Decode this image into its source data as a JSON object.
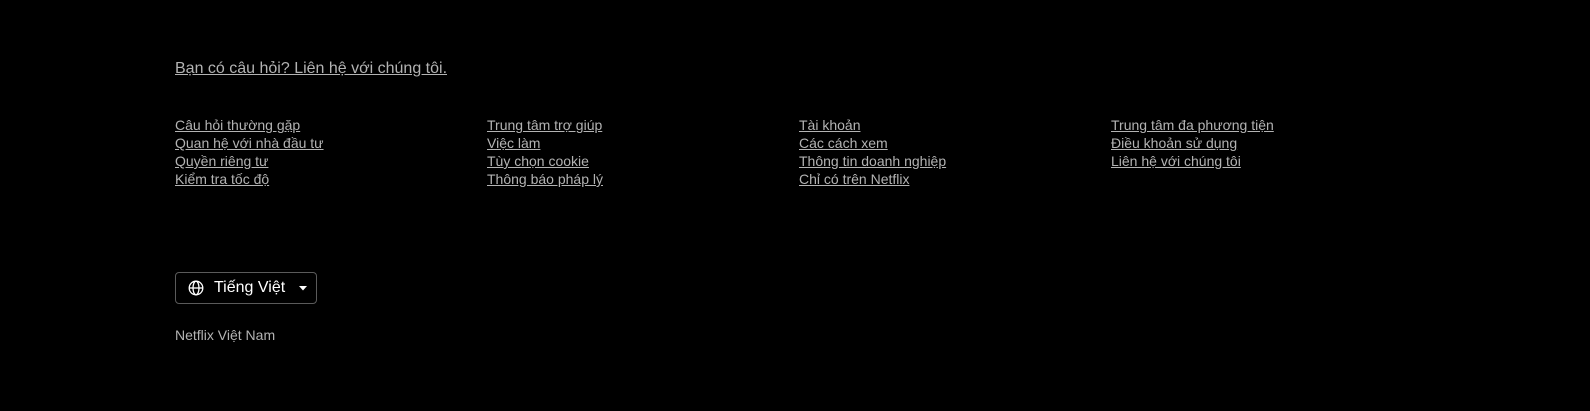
{
  "footer": {
    "contact_text": "Bạn có câu hỏi? Liên hệ với chúng tôi.",
    "columns": [
      [
        "Câu hỏi thường gặp",
        "Quan hệ với nhà đầu tư",
        "Quyền riêng tư",
        "Kiểm tra tốc độ"
      ],
      [
        "Trung tâm trợ giúp",
        "Việc làm",
        "Tùy chọn cookie",
        "Thông báo pháp lý"
      ],
      [
        "Tài khoản",
        "Các cách xem",
        "Thông tin doanh nghiệp",
        "Chỉ có trên Netflix"
      ],
      [
        "Trung tâm đa phương tiện",
        "Điều khoản sử dụng",
        "Liên hệ với chúng tôi"
      ]
    ],
    "language_selector": {
      "selected": "Tiếng Việt",
      "icon": "globe-icon",
      "caret_icon": "caret-down-icon"
    },
    "country_label": "Netflix Việt Nam"
  },
  "colors": {
    "background": "#000000",
    "text_muted": "#b3b3b3",
    "text_primary": "#ffffff",
    "border": "#5a5a5a"
  }
}
